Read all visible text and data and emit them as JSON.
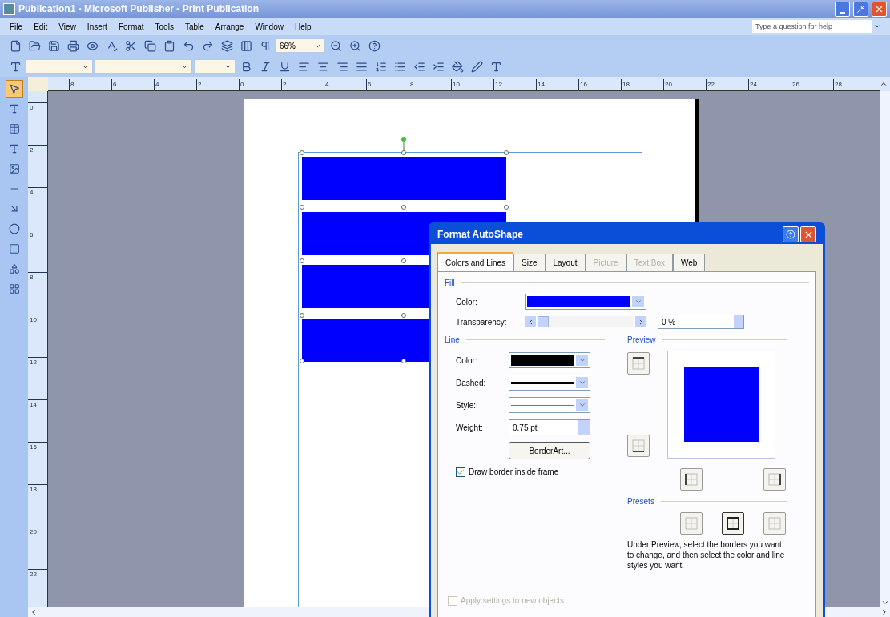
{
  "window": {
    "title": "Publication1 - Microsoft Publisher - Print Publication"
  },
  "menu": [
    "File",
    "Edit",
    "View",
    "Insert",
    "Format",
    "Tools",
    "Table",
    "Arrange",
    "Window",
    "Help"
  ],
  "help_box": {
    "placeholder": "Type a question for help"
  },
  "zoom_box": {
    "value": "66%"
  },
  "top_ruler": [
    "8",
    "6",
    "4",
    "2",
    "0",
    "2",
    "4",
    "6",
    "8",
    "10",
    "12",
    "14",
    "16",
    "18",
    "20",
    "22",
    "24",
    "26",
    "28"
  ],
  "left_ruler": [
    "0",
    "2",
    "4",
    "6",
    "8",
    "10",
    "12",
    "14",
    "16",
    "18",
    "20",
    "22"
  ],
  "tools": [
    {
      "kind": "pointer",
      "selected": true
    },
    {
      "kind": "text",
      "selected": false
    },
    {
      "kind": "table",
      "selected": false
    },
    {
      "kind": "wordart",
      "selected": false
    },
    {
      "kind": "picture",
      "selected": false
    },
    {
      "kind": "line",
      "selected": false
    },
    {
      "kind": "arrow",
      "selected": false
    },
    {
      "kind": "oval",
      "selected": false
    },
    {
      "kind": "rectangle",
      "selected": false
    },
    {
      "kind": "autoshapes",
      "selected": false
    },
    {
      "kind": "gallery",
      "selected": false
    }
  ],
  "shapes": [
    {
      "color": "#0000ff"
    },
    {
      "color": "#0000ff"
    },
    {
      "color": "#0000ff"
    },
    {
      "color": "#0000ff"
    }
  ],
  "dialog": {
    "title": "Format AutoShape",
    "tabs": [
      {
        "label": "Colors and Lines",
        "selected": true,
        "disabled": false
      },
      {
        "label": "Size",
        "selected": false,
        "disabled": false
      },
      {
        "label": "Layout",
        "selected": false,
        "disabled": false
      },
      {
        "label": "Picture",
        "selected": false,
        "disabled": true
      },
      {
        "label": "Text Box",
        "selected": false,
        "disabled": true
      },
      {
        "label": "Web",
        "selected": false,
        "disabled": false
      }
    ],
    "fill": {
      "heading": "Fill",
      "color_label": "Color:",
      "color": "#0000ff",
      "transparency_label": "Transparency:",
      "transparency": {
        "level": 0
      },
      "transparency_value": "0 %"
    },
    "line": {
      "heading": "Line",
      "color_label": "Color:",
      "color": "#000000",
      "dashed_label": "Dashed:",
      "style_label": "Style:",
      "weight_label": "Weight:",
      "weight_value": "0.75 pt",
      "borderart_button": "BorderArt...",
      "inside_frame": {
        "label": "Draw border inside frame",
        "checked": true
      }
    },
    "preview": {
      "heading": "Preview",
      "color": "#0000ff"
    },
    "presets": {
      "heading": "Presets"
    },
    "hint": "Under Preview, select the borders you want to change, and then select the color and line styles you want.",
    "apply_new": {
      "label": "Apply settings to new objects",
      "checked": false,
      "disabled": true
    }
  }
}
